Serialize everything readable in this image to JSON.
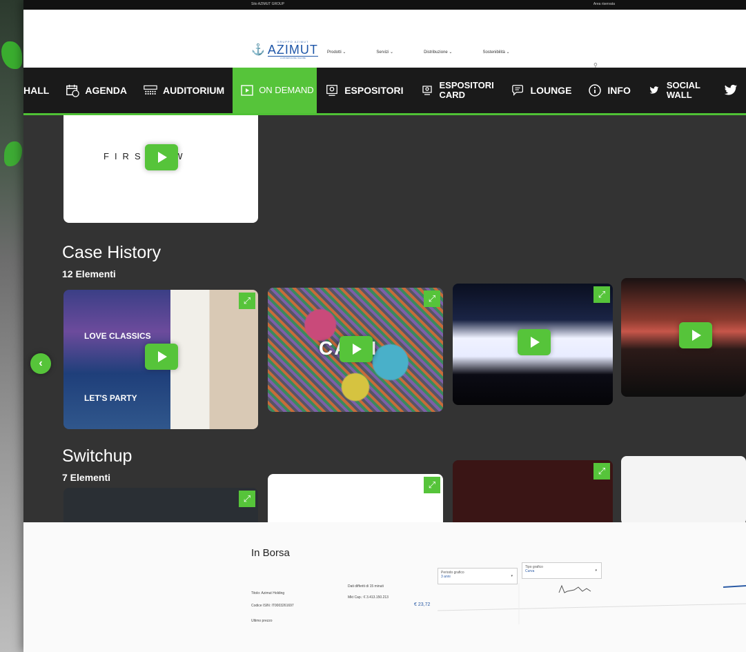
{
  "top_bar": {
    "group_label": "Sito AZIMUT GROUP",
    "right_link": "Area riservata"
  },
  "azimut_header": {
    "logo_small": "GRUPPO AZIMUT",
    "logo_big": "AZIMUT",
    "logo_tagline": "LA RICERCA DEL VALORE",
    "nav": [
      "Prodotti ⌄",
      "Servizi ⌄",
      "Distribuzione ⌄",
      "Sostenibilità ⌄"
    ]
  },
  "main_nav": {
    "items": [
      {
        "label": "HALL",
        "icon": "hall"
      },
      {
        "label": "AGENDA",
        "icon": "calendar-icon"
      },
      {
        "label": "AUDITORIUM",
        "icon": "auditorium-icon"
      },
      {
        "label": "ON DEMAND",
        "icon": "play-icon",
        "active": true
      },
      {
        "label": "ESPOSITORI",
        "icon": "exhibitor-icon"
      },
      {
        "label": "ESPOSITORI CARD",
        "icon": "card-icon"
      },
      {
        "label": "LOUNGE",
        "icon": "chat-icon"
      },
      {
        "label": "INFO",
        "icon": "info-icon"
      },
      {
        "label": "SOCIAL WALL",
        "icon": "twitter-icon"
      }
    ],
    "accent": "#56c43a"
  },
  "first_card": {
    "brand": "FIRS R W"
  },
  "case_history": {
    "title": "Case History",
    "count": "12 Elementi",
    "thumb1_labels": [
      "LOVE CLASSICS",
      "LET'S PARTY"
    ],
    "thumb2_word": "CA RI"
  },
  "switchup": {
    "title": "Switchup",
    "count": "7 Elementi"
  },
  "borsa": {
    "title": "In Borsa",
    "titolo": "Titolo: Azimut Holding",
    "isin": "Codice ISIN: IT0003261697",
    "ultimo": "Ultimo prezzo",
    "dati": "Dati differiti di 15 minuti",
    "mkt_cap": "Mkt Cap.: € 3.413.150.213",
    "price": "€ 23,72",
    "select1_label": "Periodo grafico",
    "select1_value": "3 anni",
    "select2_label": "Tipo grafico",
    "select2_value": "Curva"
  }
}
